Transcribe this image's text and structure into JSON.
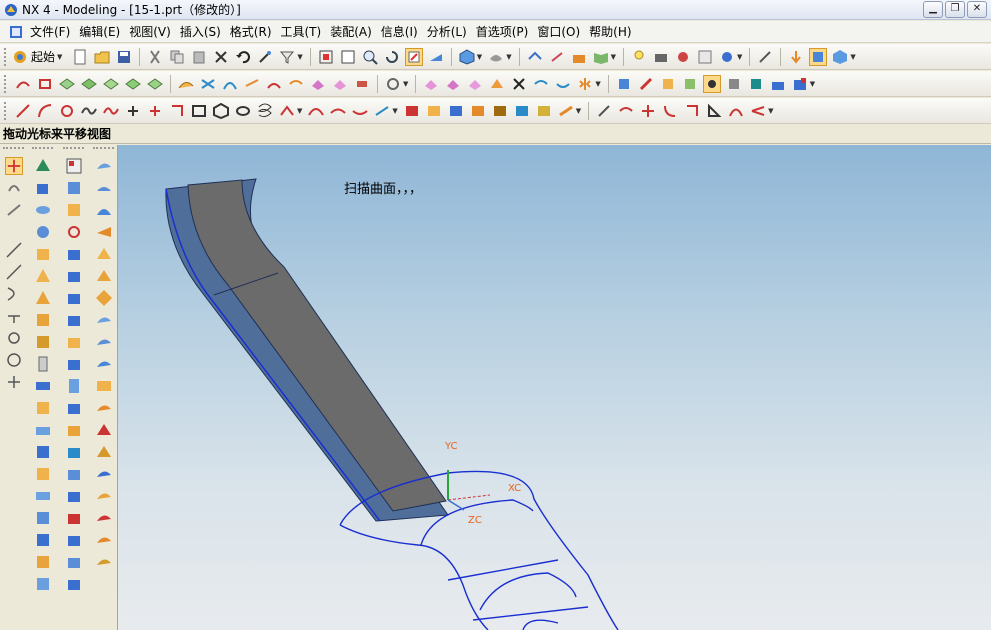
{
  "window": {
    "title": "NX 4 - Modeling - [15-1.prt（修改的）]",
    "min_glyph": "▁",
    "max_glyph": "❐",
    "close_glyph": "✕"
  },
  "menu": [
    {
      "label": "文件(F)"
    },
    {
      "label": "编辑(E)"
    },
    {
      "label": "视图(V)"
    },
    {
      "label": "插入(S)"
    },
    {
      "label": "格式(R)"
    },
    {
      "label": "工具(T)"
    },
    {
      "label": "装配(A)"
    },
    {
      "label": "信息(I)"
    },
    {
      "label": "分析(L)"
    },
    {
      "label": "首选项(P)"
    },
    {
      "label": "窗口(O)"
    },
    {
      "label": "帮助(H)"
    }
  ],
  "toolbar": {
    "start_label": "起始",
    "drop_glyph": "▼"
  },
  "cue": {
    "text": "拖动光标来平移视图"
  },
  "viewport": {
    "annotation": "扫描曲面，，，",
    "axes": {
      "yc": "YC",
      "xc": "XC",
      "zc": "ZC"
    }
  },
  "colors": {
    "accent": "#1f4fb5",
    "solid_top": "#6b6b6b",
    "solid_side": "#4f6f9a",
    "curve": "#1a2fd0",
    "axis_label": "#e8641c"
  }
}
